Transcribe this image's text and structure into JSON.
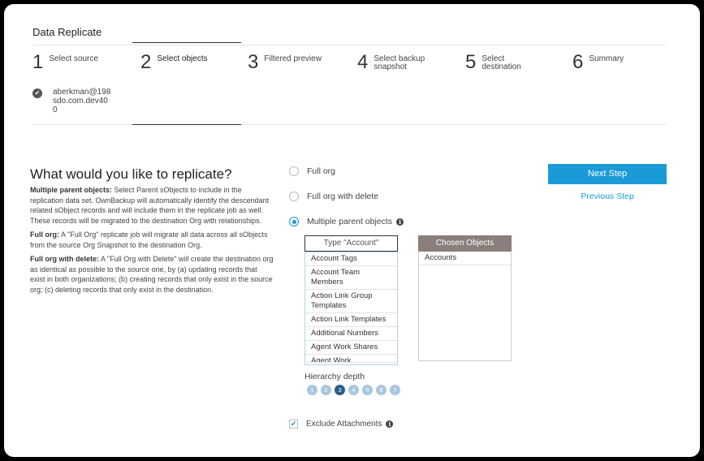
{
  "app": {
    "title": "Data Replicate"
  },
  "steps": [
    {
      "num": "1",
      "label": [
        "Select source"
      ]
    },
    {
      "num": "2",
      "label": [
        "Select objects"
      ]
    },
    {
      "num": "3",
      "label": [
        "Filtered preview"
      ]
    },
    {
      "num": "4",
      "label": [
        "Select backup",
        "snapshot"
      ]
    },
    {
      "num": "5",
      "label": [
        "Select",
        "destination"
      ]
    },
    {
      "num": "6",
      "label": [
        "Summary"
      ]
    }
  ],
  "source_account": {
    "lines": [
      "aberkman@198",
      "sdo.com.dev40",
      "0"
    ]
  },
  "main": {
    "heading": "What would you like to replicate?",
    "desc": [
      {
        "bold": "Multiple parent objects:",
        "text": " Select Parent sObjects to include in the replication data set. OwnBackup will automatically identify the descendant related sObject records and will include them in the replicate job as well. These records will be migrated to the destination Org with relationships."
      },
      {
        "bold": "Full org:",
        "text": " A \"Full Org\" replicate job will migrate all data across all sObjects from the source Org Snapshot to the destination Org."
      },
      {
        "bold": "Full org with delete:",
        "text": " A \"Full Org with Delete\" will create the destination org as identical as possible to the source one, by (a) updating records that exist in both organizations; (b) creating records that only exist in the source org; (c) deleting records that only exist in the destination."
      }
    ]
  },
  "options": {
    "full_org": "Full org",
    "full_org_delete": "Full org with delete",
    "multiple_parent": "Multiple parent objects"
  },
  "search": {
    "placeholder": "Type \"Account\""
  },
  "available_objects": [
    "Account Tags",
    "Account Team Members",
    "Action Link Group Templates",
    "Action Link Templates",
    "Additional Numbers",
    "Agent Work Shares",
    "Agent Work"
  ],
  "chosen": {
    "header": "Chosen Objects",
    "items": [
      "Accounts"
    ]
  },
  "hierarchy": {
    "label": "Hierarchy depth",
    "levels": [
      "1",
      "2",
      "3",
      "4",
      "5",
      "6",
      "7"
    ],
    "selected": "3"
  },
  "exclude_attachments": {
    "label": "Exclude Attachments",
    "checked": true
  },
  "actions": {
    "next": "Next Step",
    "previous": "Previous Step"
  },
  "colors": {
    "accent": "#1a9bd7",
    "chosen_header": "#8a7f7b",
    "depth_selected": "#2a5b8a"
  }
}
